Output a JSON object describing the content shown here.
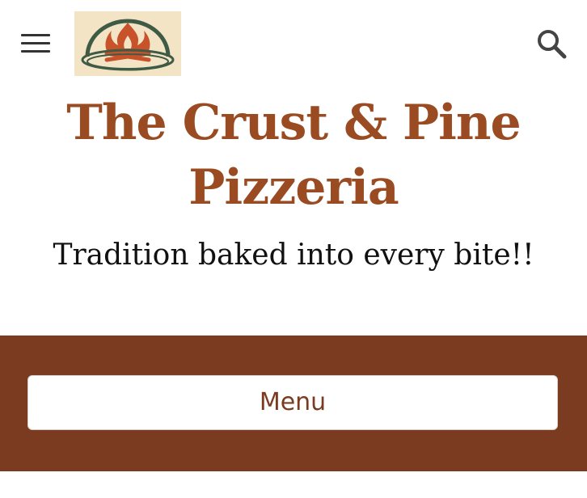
{
  "header": {
    "menu_icon": "hamburger-icon",
    "logo_icon": "fire-hearth-logo",
    "search_icon": "search-icon"
  },
  "site": {
    "title_line1": "The Crust & Pine",
    "title_line2": "Pizzeria",
    "tagline": "Tradition baked into every bite!!"
  },
  "nav": {
    "menu_label": "Menu"
  },
  "colors": {
    "title": "#9a4b21",
    "band": "#7a3b21",
    "logo_bg": "#f3e4c6"
  }
}
